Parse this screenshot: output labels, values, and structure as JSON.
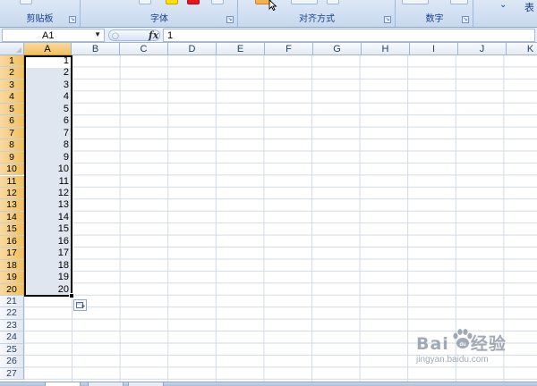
{
  "ribbon": {
    "groups": [
      {
        "label": "剪贴板"
      },
      {
        "label": "字体"
      },
      {
        "label": "对齐方式"
      },
      {
        "label": "数字"
      }
    ],
    "partial_label": "表"
  },
  "formula_bar": {
    "name_box": "A1",
    "fx": "fx",
    "formula": "1"
  },
  "columns": [
    "A",
    "B",
    "C",
    "D",
    "E",
    "F",
    "G",
    "H",
    "I",
    "J",
    "K"
  ],
  "rows": [
    "1",
    "2",
    "3",
    "4",
    "5",
    "6",
    "7",
    "8",
    "9",
    "10",
    "11",
    "12",
    "13",
    "14",
    "15",
    "16",
    "17",
    "18",
    "19",
    "20",
    "21",
    "22",
    "23",
    "24",
    "25",
    "26",
    "27"
  ],
  "cells_A": [
    "1",
    "2",
    "3",
    "4",
    "5",
    "6",
    "7",
    "8",
    "9",
    "10",
    "11",
    "12",
    "13",
    "14",
    "15",
    "16",
    "17",
    "18",
    "19",
    "20"
  ],
  "selection": {
    "range_rows": 20,
    "column": "A"
  },
  "watermark": {
    "logo_left": "Bai",
    "logo_right": "经验",
    "url": "jingyan.baidu.com"
  },
  "colors": {
    "selected_header": "#f1c15f",
    "selection_fill": "#dfe6ef",
    "ribbon_label": "#15428b"
  }
}
